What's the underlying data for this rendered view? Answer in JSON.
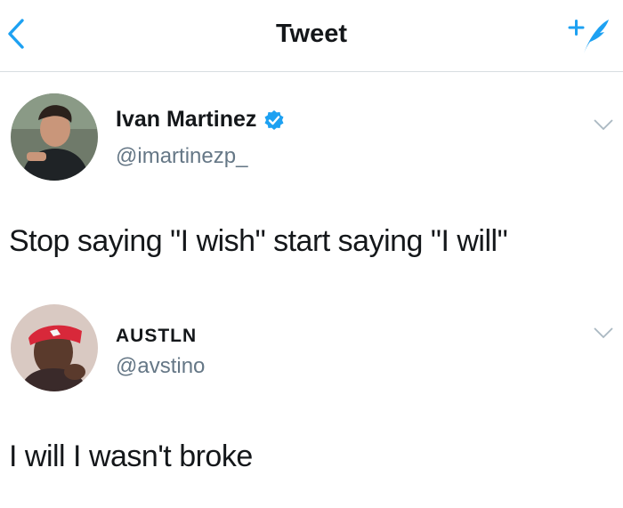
{
  "nav": {
    "title": "Tweet",
    "back_icon": "chevron-left-icon",
    "compose_icon": "compose-tweet-icon",
    "accent_color": "#1da1f2"
  },
  "tweets": [
    {
      "display_name": "Ivan Martinez",
      "handle": "@imartinezp_",
      "verified": true,
      "text": "Stop saying \"I wish\" start saying \"I will\""
    },
    {
      "display_name": "AUSTLN",
      "handle": "@avstino",
      "verified": false,
      "text": "I will I wasn't broke"
    }
  ]
}
